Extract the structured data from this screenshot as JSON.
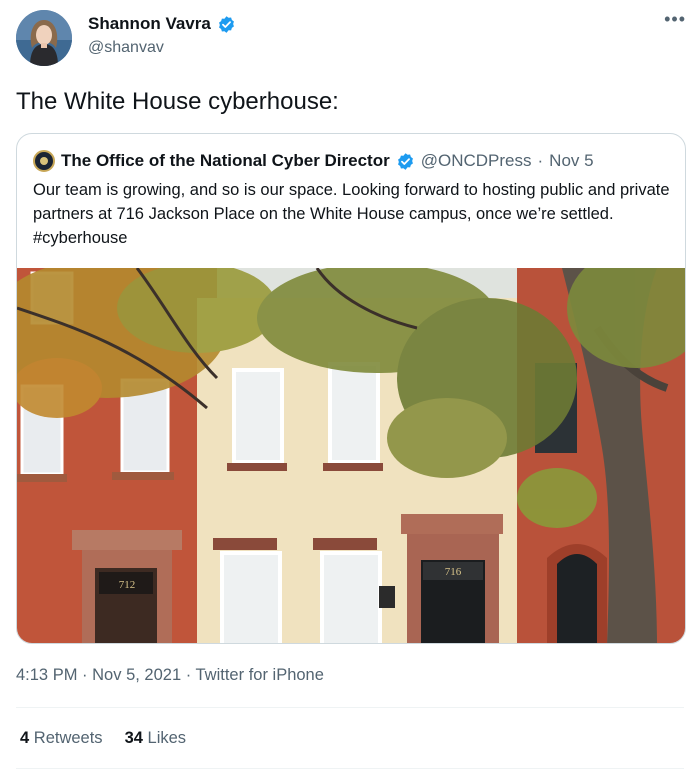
{
  "author": {
    "name": "Shannon Vavra",
    "handle": "@shanvav",
    "verified_color": "#1d9bf0"
  },
  "more_icon": "more-horizontal-icon",
  "tweet": {
    "text": "The White House cyberhouse:"
  },
  "quoted": {
    "name": "The Office of the National Cyber Director",
    "handle": "@ONCDPress",
    "separator": "·",
    "date": "Nov 5",
    "text": "Our team is growing, and so is our space. Looking forward to hosting public and private partners at 716 Jackson Place on the White House campus, once we’re settled. #cyberhouse",
    "image": {
      "house_number_left": "712",
      "house_number_right": "716"
    }
  },
  "meta": {
    "time": "4:13 PM",
    "sep1": "·",
    "date": "Nov 5, 2021",
    "sep2": "·",
    "source": "Twitter for iPhone"
  },
  "stats": {
    "retweets_count": "4",
    "retweets_label": "Retweets",
    "likes_count": "34",
    "likes_label": "Likes"
  }
}
